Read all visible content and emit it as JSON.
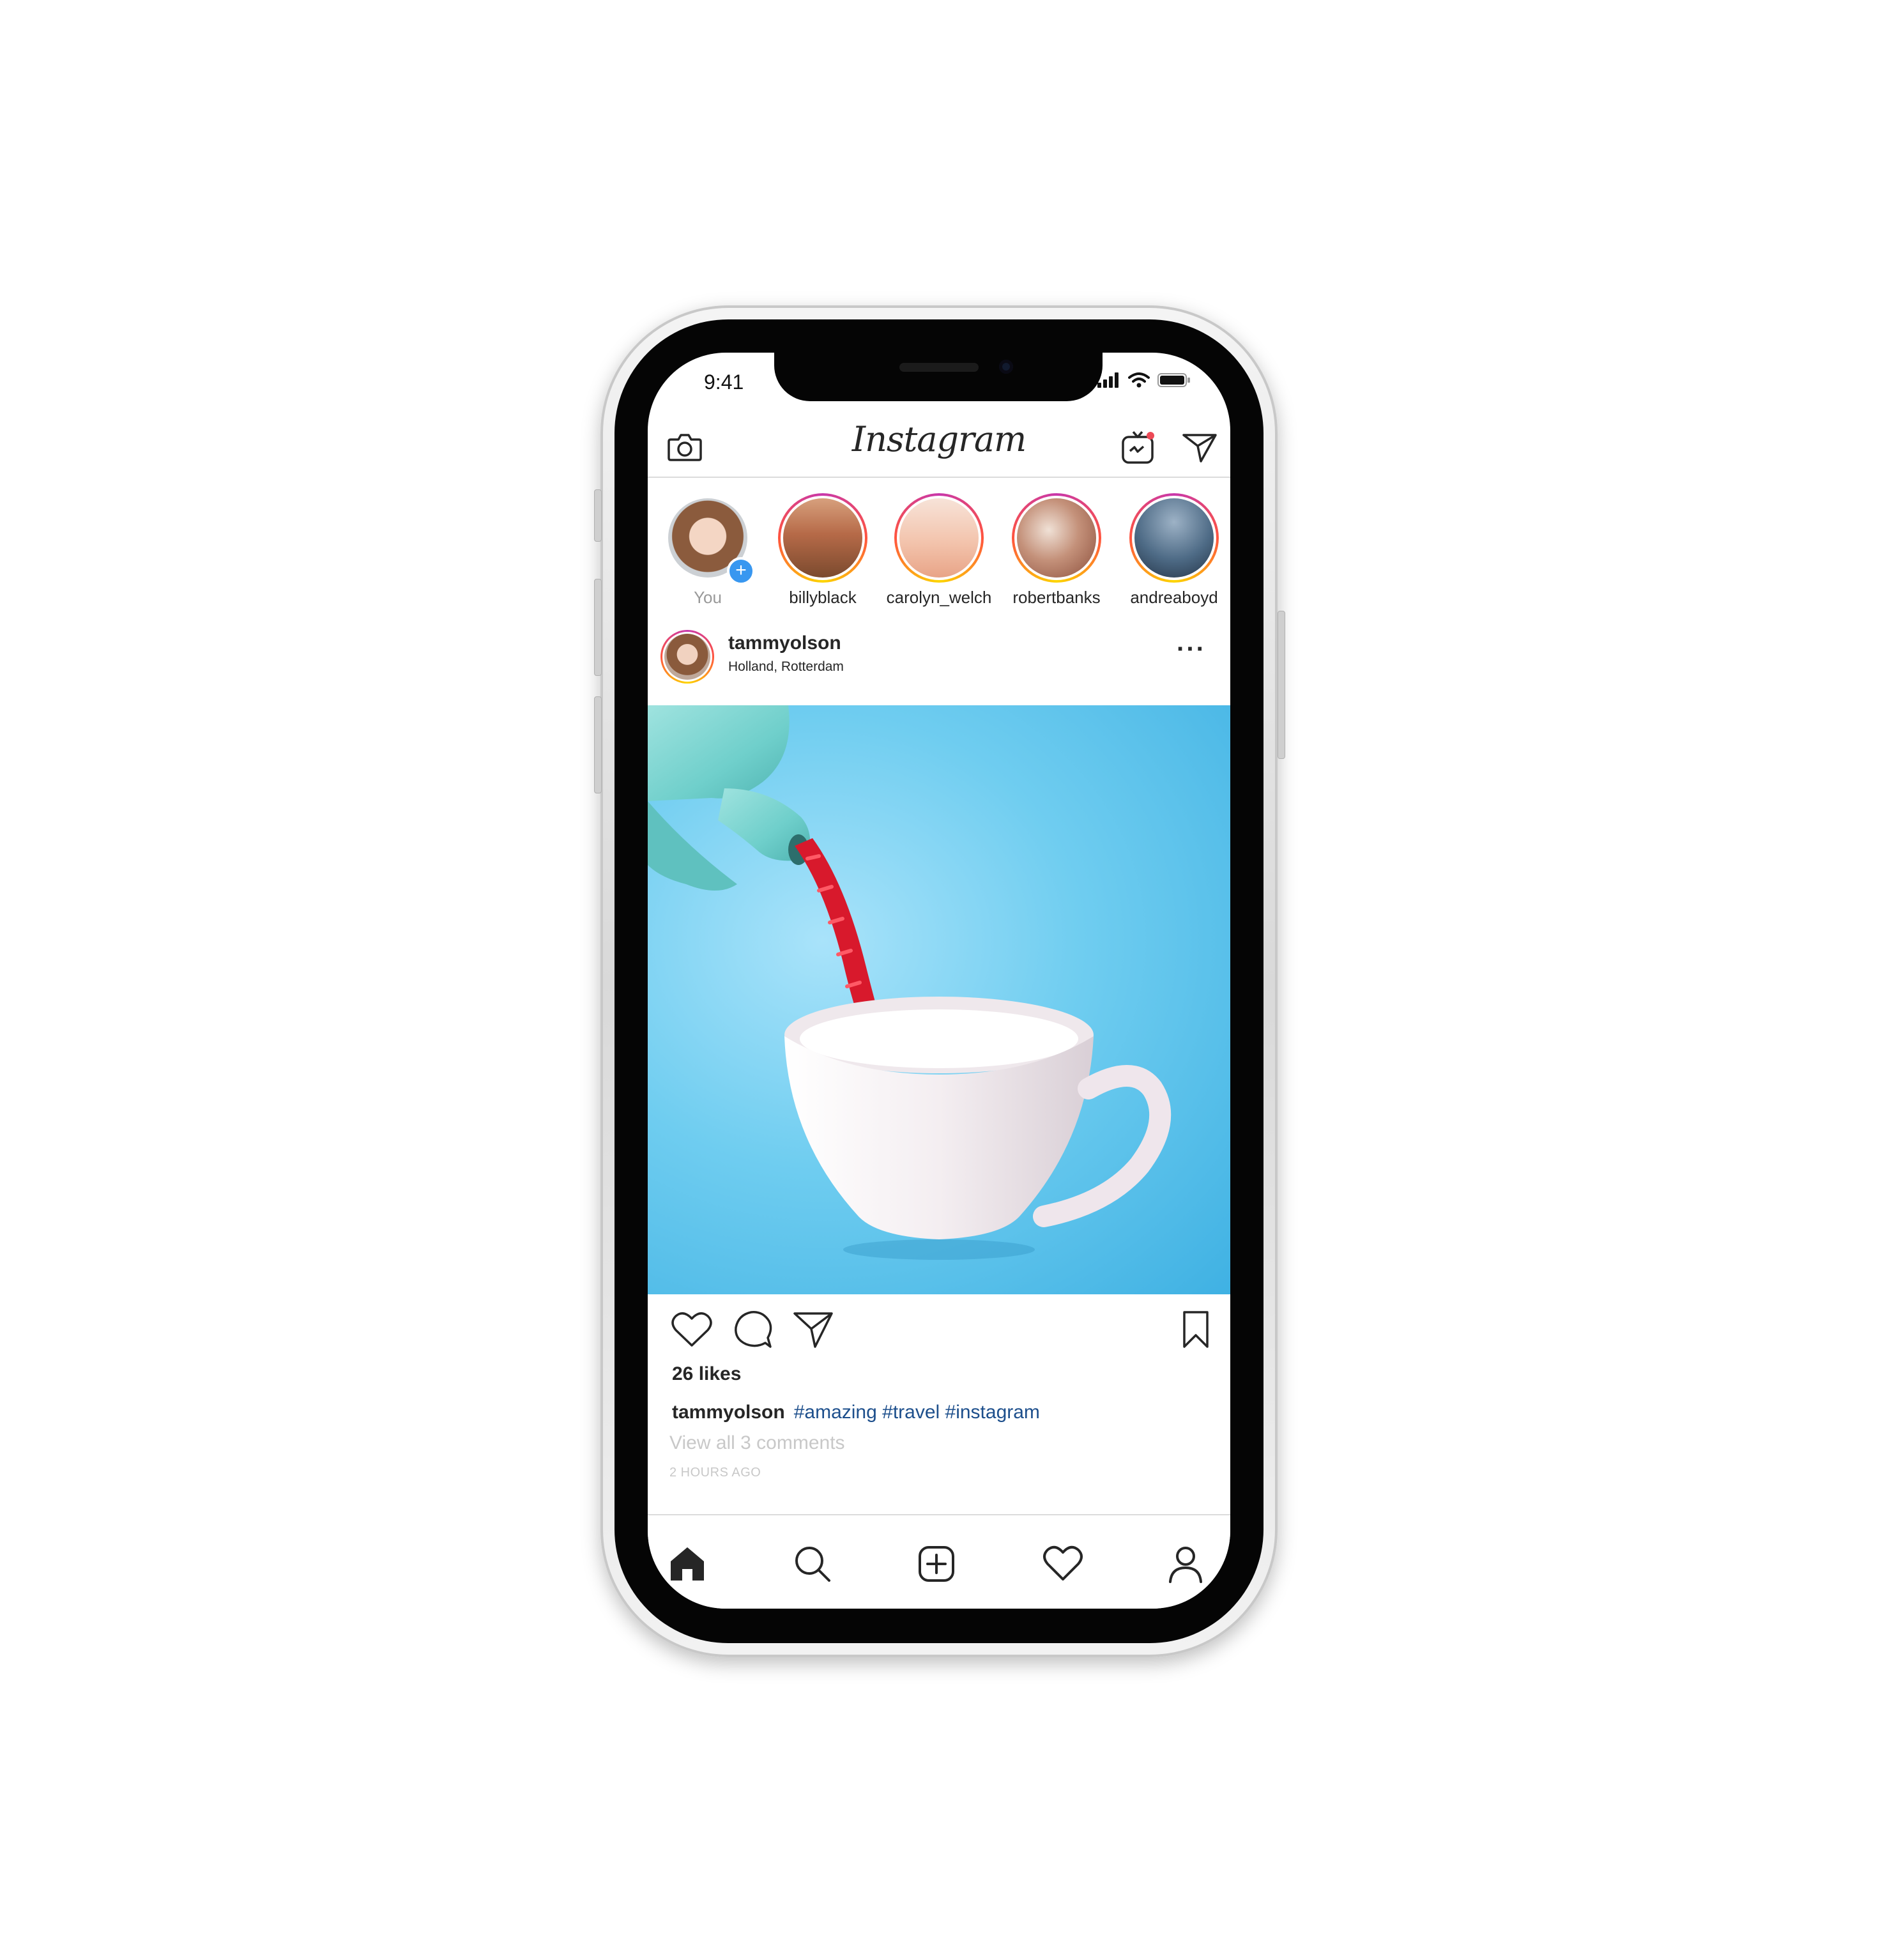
{
  "status_bar": {
    "time": "9:41"
  },
  "header": {
    "logo_text": "Instagram",
    "left_icon": "camera-icon",
    "right_icons": [
      "igtv-icon",
      "direct-message-icon"
    ]
  },
  "stories": [
    {
      "name": "You",
      "own": true
    },
    {
      "name": "billyblack"
    },
    {
      "name": "carolyn_welch"
    },
    {
      "name": "robertbanks"
    },
    {
      "name": "andreaboyd"
    }
  ],
  "post": {
    "username": "tammyolson",
    "location": "Holland, Rotterdam",
    "more": "···",
    "likes": "26 likes",
    "caption_user": "tammyolson",
    "caption_tags": "#amazing #travel #instagram",
    "view_comments": "View all 3 comments",
    "time_ago": "2 HOURS AGO"
  },
  "actions": [
    "heart-icon",
    "comment-icon",
    "share-icon",
    "bookmark-icon"
  ],
  "tabbar": [
    "home-icon",
    "search-icon",
    "add-post-icon",
    "activity-heart-icon",
    "profile-icon"
  ],
  "colors": {
    "link_blue": "#1d4f8c",
    "badge_blue": "#3897f0",
    "story_ring": "#c837ab",
    "image_bg": "#6fcdf0"
  }
}
